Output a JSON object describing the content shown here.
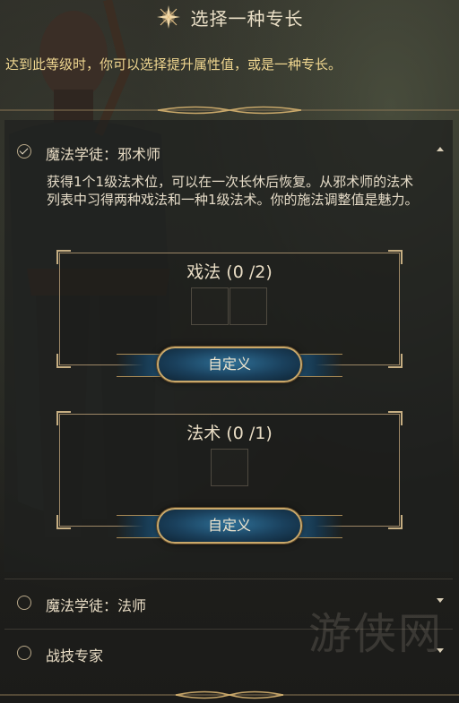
{
  "header": {
    "title": "选择一种专长",
    "icon": "star-icon",
    "subtitle": "达到此等级时，你可以选择提升属性值，或是一种专长。"
  },
  "feats": [
    {
      "label": "魔法学徒：邪术师",
      "selected": true,
      "expanded": true,
      "description": "获得1个1级法术位，可以在一次长休后恢复。从邪术师的法术列表中习得两种戏法和一种1级法术。你的施法调整值是魅力。",
      "choices": [
        {
          "title": "戏法 (0 /2)",
          "slots": 2,
          "button": "自定义"
        },
        {
          "title": "法术 (0 /1)",
          "slots": 1,
          "button": "自定义"
        }
      ]
    },
    {
      "label": "魔法学徒：法师",
      "selected": false,
      "expanded": false
    },
    {
      "label": "战技专家",
      "selected": false,
      "expanded": false
    }
  ],
  "watermark": "游侠网",
  "colors": {
    "accent_gold": "#c9a86a",
    "subtitle": "#efd690",
    "button_blue": "#1a405c"
  }
}
